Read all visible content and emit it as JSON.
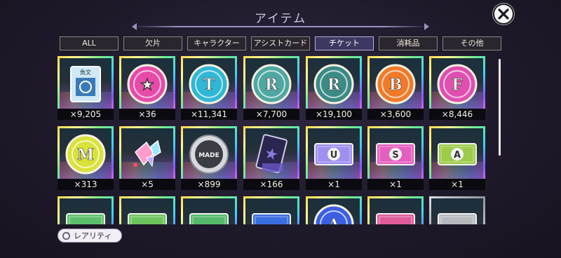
{
  "header": {
    "title": "アイテム"
  },
  "tabs": [
    {
      "label": "ALL",
      "active": false
    },
    {
      "label": "欠片",
      "active": false
    },
    {
      "label": "キャラクター",
      "active": false
    },
    {
      "label": "アシストカード",
      "active": false
    },
    {
      "label": "チケット",
      "active": true
    },
    {
      "label": "消耗品",
      "active": false
    },
    {
      "label": "その他",
      "active": false
    }
  ],
  "items": [
    {
      "icon": "memory-card-icon",
      "count": "×9,205",
      "glyph": "",
      "card_text": "魚文",
      "color": "#cfe9f7"
    },
    {
      "icon": "star-coin-icon",
      "count": "×36",
      "glyph": "★",
      "color": "#e84aa8"
    },
    {
      "icon": "t-coin-icon",
      "count": "×11,341",
      "glyph": "T",
      "color": "#2fb7d6"
    },
    {
      "icon": "r-coin-icon",
      "count": "×7,700",
      "glyph": "R",
      "color": "#4fa7a1"
    },
    {
      "icon": "r-coin-dark-icon",
      "count": "×19,100",
      "glyph": "R",
      "color": "#3c8a86"
    },
    {
      "icon": "b-coin-icon",
      "count": "×3,600",
      "glyph": "B",
      "color": "#f07a28"
    },
    {
      "icon": "f-coin-icon",
      "count": "×8,446",
      "glyph": "F",
      "color": "#e04fb0"
    },
    {
      "icon": "m-coin-icon",
      "count": "×313",
      "glyph": "M",
      "color": "#d9e23a"
    },
    {
      "icon": "crystal-shard-icon",
      "count": "×5",
      "glyph": "",
      "color": "#ff8fb4"
    },
    {
      "icon": "silver-medal-icon",
      "count": "×899",
      "glyph": "",
      "medal_text": "MADE",
      "color": "#c9ccd2"
    },
    {
      "icon": "star-card-icon",
      "count": "×166",
      "glyph": "★",
      "color": "#8a7bd8"
    },
    {
      "icon": "u-ticket-icon",
      "count": "×1",
      "glyph": "U",
      "color": "#9f8ff0"
    },
    {
      "icon": "s-ticket-icon",
      "count": "×1",
      "glyph": "S",
      "color": "#e55fc0"
    },
    {
      "icon": "a-ticket-icon",
      "count": "×1",
      "glyph": "A",
      "color": "#9ecb4a"
    },
    {
      "icon": "green-ticket-icon",
      "count": "",
      "glyph": "",
      "color": "#5cc06a"
    },
    {
      "icon": "green-ticket-2-icon",
      "count": "",
      "glyph": "",
      "color": "#6cc55c"
    },
    {
      "icon": "green-ticket-3-icon",
      "count": "",
      "glyph": "",
      "color": "#55b96b"
    },
    {
      "icon": "blue-card-icon",
      "count": "",
      "glyph": "",
      "color": "#3b6fe0"
    },
    {
      "icon": "blue-coin-icon",
      "count": "",
      "glyph": "A",
      "color": "#3b5fe0"
    },
    {
      "icon": "pink-ticket-icon",
      "count": "",
      "glyph": "",
      "color": "#e05b9a"
    },
    {
      "icon": "silver-ticket-icon",
      "count": "",
      "glyph": "",
      "color": "#b7babf"
    }
  ],
  "footer": {
    "rarity_label": "レアリティ"
  }
}
